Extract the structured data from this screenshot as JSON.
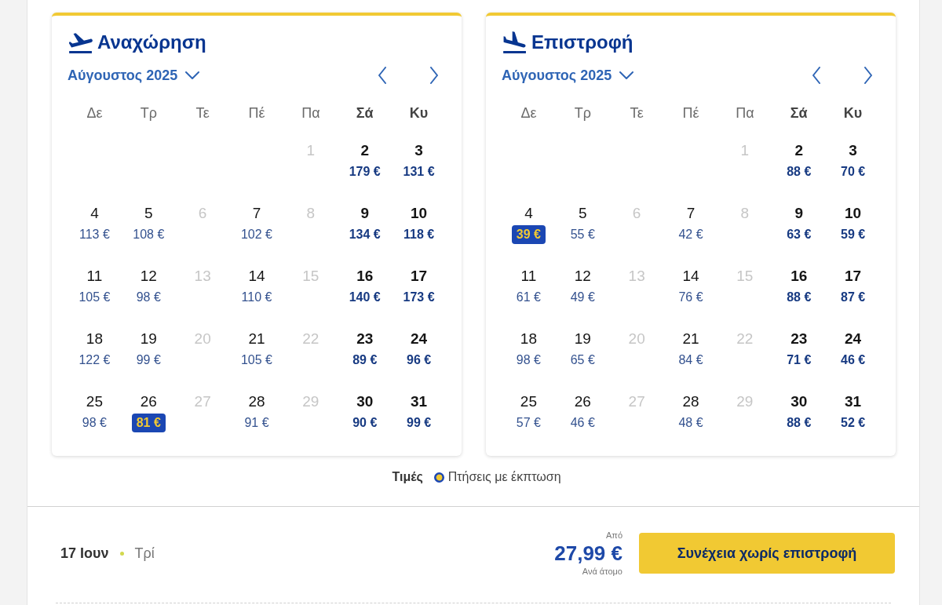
{
  "calendars": [
    {
      "kind": "departure",
      "title": "Αναχώρηση",
      "month": "Αύγουστος 2025",
      "weekdays": [
        {
          "label": "Δε",
          "weekend": false
        },
        {
          "label": "Τρ",
          "weekend": false
        },
        {
          "label": "Τε",
          "weekend": false
        },
        {
          "label": "Πέ",
          "weekend": false
        },
        {
          "label": "Πα",
          "weekend": false
        },
        {
          "label": "Σά",
          "weekend": true
        },
        {
          "label": "Κυ",
          "weekend": true
        }
      ],
      "weeks": [
        {
          "days": [
            {
              "day": "1",
              "available": false,
              "selected": false
            },
            {
              "day": "2",
              "price": "179 €",
              "available": true,
              "selected": false
            },
            {
              "day": "3",
              "price": "131 €",
              "available": true,
              "selected": false
            }
          ]
        },
        {
          "days": [
            {
              "day": "4",
              "price": "113 €",
              "available": true,
              "selected": false
            },
            {
              "day": "5",
              "price": "108 €",
              "available": true,
              "selected": false
            },
            {
              "day": "6",
              "available": false,
              "selected": false
            },
            {
              "day": "7",
              "price": "102 €",
              "available": true,
              "selected": false
            },
            {
              "day": "8",
              "available": false,
              "selected": false
            },
            {
              "day": "9",
              "price": "134 €",
              "available": true,
              "selected": false
            },
            {
              "day": "10",
              "price": "118 €",
              "available": true,
              "selected": false
            }
          ]
        },
        {
          "days": [
            {
              "day": "11",
              "price": "105 €",
              "available": true,
              "selected": false
            },
            {
              "day": "12",
              "price": "98 €",
              "available": true,
              "selected": false
            },
            {
              "day": "13",
              "available": false,
              "selected": false
            },
            {
              "day": "14",
              "price": "110 €",
              "available": true,
              "selected": false
            },
            {
              "day": "15",
              "available": false,
              "selected": false
            },
            {
              "day": "16",
              "price": "140 €",
              "available": true,
              "selected": false
            },
            {
              "day": "17",
              "price": "173 €",
              "available": true,
              "selected": false
            }
          ]
        },
        {
          "days": [
            {
              "day": "18",
              "price": "122 €",
              "available": true,
              "selected": false
            },
            {
              "day": "19",
              "price": "99 €",
              "available": true,
              "selected": false
            },
            {
              "day": "20",
              "available": false,
              "selected": false
            },
            {
              "day": "21",
              "price": "105 €",
              "available": true,
              "selected": false
            },
            {
              "day": "22",
              "available": false,
              "selected": false
            },
            {
              "day": "23",
              "price": "89 €",
              "available": true,
              "selected": false
            },
            {
              "day": "24",
              "price": "96 €",
              "available": true,
              "selected": false
            }
          ]
        },
        {
          "days": [
            {
              "day": "25",
              "price": "98 €",
              "available": true,
              "selected": false
            },
            {
              "day": "26",
              "price": "81 €",
              "available": true,
              "selected": true
            },
            {
              "day": "27",
              "available": false,
              "selected": false
            },
            {
              "day": "28",
              "price": "91 €",
              "available": true,
              "selected": false
            },
            {
              "day": "29",
              "available": false,
              "selected": false
            },
            {
              "day": "30",
              "price": "90 €",
              "available": true,
              "selected": false
            },
            {
              "day": "31",
              "price": "99 €",
              "available": true,
              "selected": false
            }
          ]
        }
      ]
    },
    {
      "kind": "return",
      "title": "Επιστροφή",
      "month": "Αύγουστος 2025",
      "weekdays": [
        {
          "label": "Δε",
          "weekend": false
        },
        {
          "label": "Τρ",
          "weekend": false
        },
        {
          "label": "Τε",
          "weekend": false
        },
        {
          "label": "Πέ",
          "weekend": false
        },
        {
          "label": "Πα",
          "weekend": false
        },
        {
          "label": "Σά",
          "weekend": true
        },
        {
          "label": "Κυ",
          "weekend": true
        }
      ],
      "weeks": [
        {
          "days": [
            {
              "day": "1",
              "available": false,
              "selected": false
            },
            {
              "day": "2",
              "price": "88 €",
              "available": true,
              "selected": false
            },
            {
              "day": "3",
              "price": "70 €",
              "available": true,
              "selected": false
            }
          ]
        },
        {
          "days": [
            {
              "day": "4",
              "price": "39 €",
              "available": true,
              "selected": true
            },
            {
              "day": "5",
              "price": "55 €",
              "available": true,
              "selected": false
            },
            {
              "day": "6",
              "available": false,
              "selected": false
            },
            {
              "day": "7",
              "price": "42 €",
              "available": true,
              "selected": false
            },
            {
              "day": "8",
              "available": false,
              "selected": false
            },
            {
              "day": "9",
              "price": "63 €",
              "available": true,
              "selected": false
            },
            {
              "day": "10",
              "price": "59 €",
              "available": true,
              "selected": false
            }
          ]
        },
        {
          "days": [
            {
              "day": "11",
              "price": "61 €",
              "available": true,
              "selected": false
            },
            {
              "day": "12",
              "price": "49 €",
              "available": true,
              "selected": false
            },
            {
              "day": "13",
              "available": false,
              "selected": false
            },
            {
              "day": "14",
              "price": "76 €",
              "available": true,
              "selected": false
            },
            {
              "day": "15",
              "available": false,
              "selected": false
            },
            {
              "day": "16",
              "price": "88 €",
              "available": true,
              "selected": false
            },
            {
              "day": "17",
              "price": "87 €",
              "available": true,
              "selected": false
            }
          ]
        },
        {
          "days": [
            {
              "day": "18",
              "price": "98 €",
              "available": true,
              "selected": false
            },
            {
              "day": "19",
              "price": "65 €",
              "available": true,
              "selected": false
            },
            {
              "day": "20",
              "available": false,
              "selected": false
            },
            {
              "day": "21",
              "price": "84 €",
              "available": true,
              "selected": false
            },
            {
              "day": "22",
              "available": false,
              "selected": false
            },
            {
              "day": "23",
              "price": "71 €",
              "available": true,
              "selected": false
            },
            {
              "day": "24",
              "price": "46 €",
              "available": true,
              "selected": false
            }
          ]
        },
        {
          "days": [
            {
              "day": "25",
              "price": "57 €",
              "available": true,
              "selected": false
            },
            {
              "day": "26",
              "price": "46 €",
              "available": true,
              "selected": false
            },
            {
              "day": "27",
              "available": false,
              "selected": false
            },
            {
              "day": "28",
              "price": "48 €",
              "available": true,
              "selected": false
            },
            {
              "day": "29",
              "available": false,
              "selected": false
            },
            {
              "day": "30",
              "price": "88 €",
              "available": true,
              "selected": false
            },
            {
              "day": "31",
              "price": "52 €",
              "available": true,
              "selected": false
            }
          ]
        }
      ]
    }
  ],
  "legend": {
    "title": "Τιμές",
    "items": [
      {
        "label": "Πτήσεις με έκπτωση"
      }
    ]
  },
  "summary": {
    "date": "17 Ιουν",
    "weekday": "Τρί",
    "price_prefix": "Από",
    "price": "27,99 €",
    "price_note": "Ανά άτομο",
    "button": "Συνέχεια χωρίς επιστροφή"
  }
}
